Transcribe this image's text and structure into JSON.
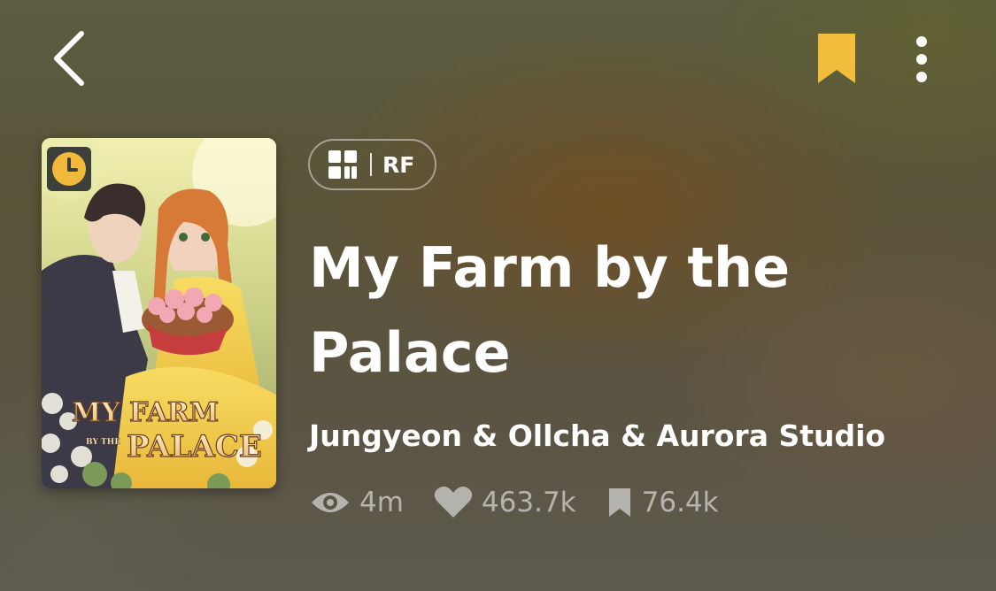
{
  "header": {
    "back_icon": "chevron-left-icon",
    "bookmark_icon": "bookmark-filled-icon",
    "bookmark_color": "#F2BC3C",
    "more_icon": "vertical-dots-icon"
  },
  "cover": {
    "art_title_line1": "MY FARM",
    "art_title_by": "BY THE",
    "art_title_line2": "PALACE",
    "badge_icon": "clock-icon",
    "badge_color": "#F1B83A"
  },
  "genre": {
    "icon": "grid-icon",
    "label": "RF"
  },
  "series": {
    "title": "My Farm by the Palace",
    "author": "Jungyeon & Ollcha & Aurora Studio"
  },
  "stats": {
    "views": "4m",
    "likes": "463.7k",
    "subscribers": "76.4k"
  }
}
